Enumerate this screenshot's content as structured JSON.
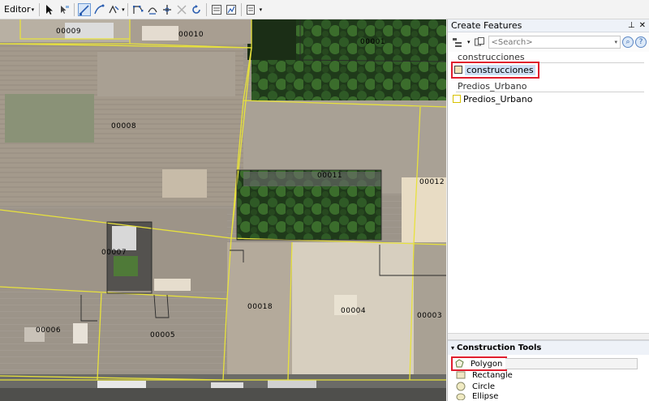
{
  "toolbar": {
    "editor_label": "Editor",
    "editor_dropdown_icon": "chevron-down-icon",
    "icons": [
      "edit-tool-icon",
      "straight-segment-icon",
      "trace-icon",
      "reshape-icon",
      "vertex-edit-icon",
      "split-icon",
      "rotate-icon",
      "delete-icon",
      "undo-icon",
      "attributes-icon",
      "sketch-properties-icon",
      "create-features-icon"
    ]
  },
  "map": {
    "parcels": [
      "00009",
      "00010",
      "00001",
      "00008",
      "00011",
      "00012",
      "00007",
      "00018",
      "00004",
      "00003",
      "00006",
      "00005"
    ],
    "parcel_outline_color": "#e8e23c"
  },
  "create_features": {
    "title": "Create Features",
    "pin_icon": "pin-icon",
    "close_icon": "close-icon",
    "search": {
      "placeholder": "<Search>",
      "value": ""
    },
    "groups": [
      {
        "name": "construcciones",
        "templates": [
          {
            "label": "construcciones",
            "swatch_fill": "#f2e3b8",
            "swatch_stroke": "#444444",
            "selected": true
          }
        ]
      },
      {
        "name": "Predios_Urbano",
        "templates": [
          {
            "label": "Predios_Urbano",
            "swatch_fill": "#ffffff",
            "swatch_stroke": "#d8c200",
            "selected": false
          }
        ]
      }
    ]
  },
  "construction_tools": {
    "title": "Construction Tools",
    "items": [
      {
        "label": "Polygon",
        "icon": "polygon-icon",
        "selected": true
      },
      {
        "label": "Rectangle",
        "icon": "rectangle-icon",
        "selected": false
      },
      {
        "label": "Circle",
        "icon": "circle-icon",
        "selected": false
      },
      {
        "label": "Ellipse",
        "icon": "ellipse-icon",
        "selected": false
      }
    ]
  },
  "colors": {
    "highlight": "#e01e2e",
    "selection": "#3a78c8"
  }
}
